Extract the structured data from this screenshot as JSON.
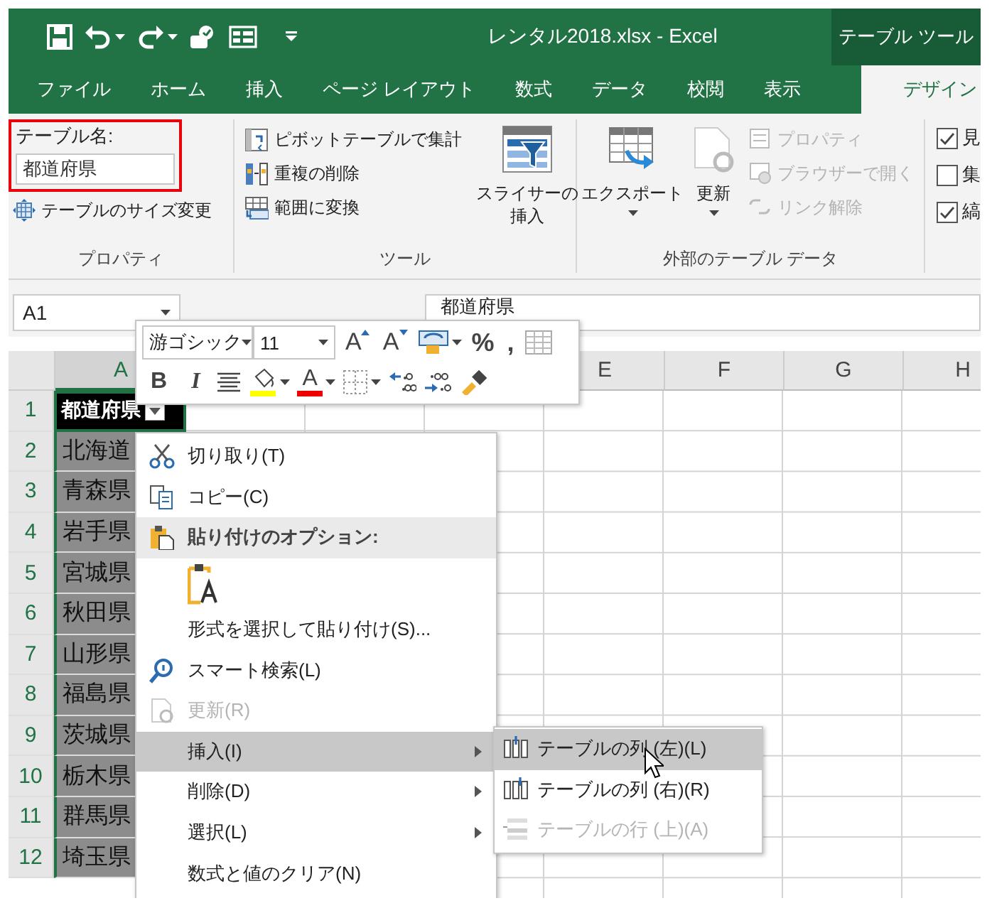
{
  "title_bar": {
    "title": "レンタル2018.xlsx  -  Excel",
    "context_title": "テーブル ツール"
  },
  "tabs": [
    {
      "label": "ファイル",
      "selected": false
    },
    {
      "label": "ホーム",
      "selected": false
    },
    {
      "label": "挿入",
      "selected": false
    },
    {
      "label": "ページ レイアウト",
      "selected": false
    },
    {
      "label": "数式",
      "selected": false
    },
    {
      "label": "データ",
      "selected": false
    },
    {
      "label": "校閲",
      "selected": false
    },
    {
      "label": "表示",
      "selected": false
    },
    {
      "label": "デザイン",
      "selected": true
    }
  ],
  "ribbon": {
    "properties": {
      "name_label": "テーブル名:",
      "name_value": "都道府県",
      "resize": "テーブルのサイズ変更",
      "label": "プロパティ"
    },
    "tools": {
      "commands": [
        "ピボットテーブルで集計",
        "重複の削除",
        "範囲に変換"
      ],
      "slicer": [
        "スライサーの",
        "挿入"
      ],
      "label": "ツール"
    },
    "external": {
      "export": "エクスポート",
      "refresh": "更新",
      "commands": [
        {
          "label": "プロパティ",
          "disabled": true
        },
        {
          "label": "ブラウザーで開く",
          "disabled": true
        },
        {
          "label": "リンク解除",
          "disabled": true
        }
      ],
      "label": "外部のテーブル データ"
    },
    "style_options": [
      {
        "label": "見",
        "checked": true
      },
      {
        "label": "集",
        "checked": false
      },
      {
        "label": "縞",
        "checked": true
      }
    ]
  },
  "formula_bar": {
    "name_box": "A1",
    "value": "都道府県"
  },
  "mini_toolbar": {
    "font": "游ゴシック",
    "size": "11",
    "row1": [
      {
        "kind": "grow",
        "label": "A"
      },
      {
        "kind": "shrink",
        "label": "A"
      },
      {
        "kind": "styles"
      },
      {
        "kind": "text",
        "label": "%"
      },
      {
        "kind": "text",
        "label": ","
      },
      {
        "kind": "table"
      }
    ],
    "row2": [
      {
        "kind": "bold",
        "label": "B"
      },
      {
        "kind": "italic",
        "label": "I"
      },
      {
        "kind": "center"
      },
      {
        "kind": "fill"
      },
      {
        "kind": "fontcolor",
        "label": "A"
      },
      {
        "kind": "border"
      },
      {
        "kind": "incdec"
      },
      {
        "kind": "decdec"
      },
      {
        "kind": "painter"
      }
    ]
  },
  "grid": {
    "columns": [
      "A",
      "E",
      "F",
      "G",
      "H"
    ],
    "rows": [
      {
        "number": "1",
        "cell": "都道府県",
        "kind": "header"
      },
      {
        "number": "2",
        "cell": "北海道",
        "kind": "data"
      },
      {
        "number": "3",
        "cell": "青森県",
        "kind": "data"
      },
      {
        "number": "4",
        "cell": "岩手県",
        "kind": "data"
      },
      {
        "number": "5",
        "cell": "宮城県",
        "kind": "data"
      },
      {
        "number": "6",
        "cell": "秋田県",
        "kind": "data"
      },
      {
        "number": "7",
        "cell": "山形県",
        "kind": "data"
      },
      {
        "number": "8",
        "cell": "福島県",
        "kind": "data"
      },
      {
        "number": "9",
        "cell": "茨城県",
        "kind": "data"
      },
      {
        "number": "10",
        "cell": "栃木県",
        "kind": "data"
      },
      {
        "number": "11",
        "cell": "群馬県",
        "kind": "data"
      },
      {
        "number": "12",
        "cell": "埼玉県",
        "kind": "data"
      }
    ]
  },
  "context_menu": [
    {
      "kind": "item",
      "label": "切り取り(T)",
      "disabled": false,
      "selected": false,
      "submenu": false
    },
    {
      "kind": "item",
      "label": "コピー(C)",
      "disabled": false,
      "selected": false,
      "submenu": false
    },
    {
      "kind": "header",
      "label": "貼り付けのオプション:"
    },
    {
      "kind": "paste"
    },
    {
      "kind": "item",
      "label": "形式を選択して貼り付け(S)...",
      "disabled": false,
      "selected": false,
      "submenu": false
    },
    {
      "kind": "item",
      "label": "スマート検索(L)",
      "disabled": false,
      "selected": false,
      "submenu": false
    },
    {
      "kind": "item",
      "label": "更新(R)",
      "disabled": true,
      "selected": false,
      "submenu": false
    },
    {
      "kind": "item",
      "label": "挿入(I)",
      "disabled": false,
      "selected": true,
      "submenu": true
    },
    {
      "kind": "item",
      "label": "削除(D)",
      "disabled": false,
      "selected": false,
      "submenu": true
    },
    {
      "kind": "item",
      "label": "選択(L)",
      "disabled": false,
      "selected": false,
      "submenu": true
    },
    {
      "kind": "item",
      "label": "数式と値のクリア(N)",
      "disabled": false,
      "selected": false,
      "submenu": false
    }
  ],
  "submenu": [
    {
      "label": "テーブルの列 (左)(L)",
      "selected": true,
      "disabled": false
    },
    {
      "label": "テーブルの列 (右)(R)",
      "selected": false,
      "disabled": false
    },
    {
      "label": "テーブルの行 (上)(A)",
      "selected": false,
      "disabled": true
    }
  ]
}
